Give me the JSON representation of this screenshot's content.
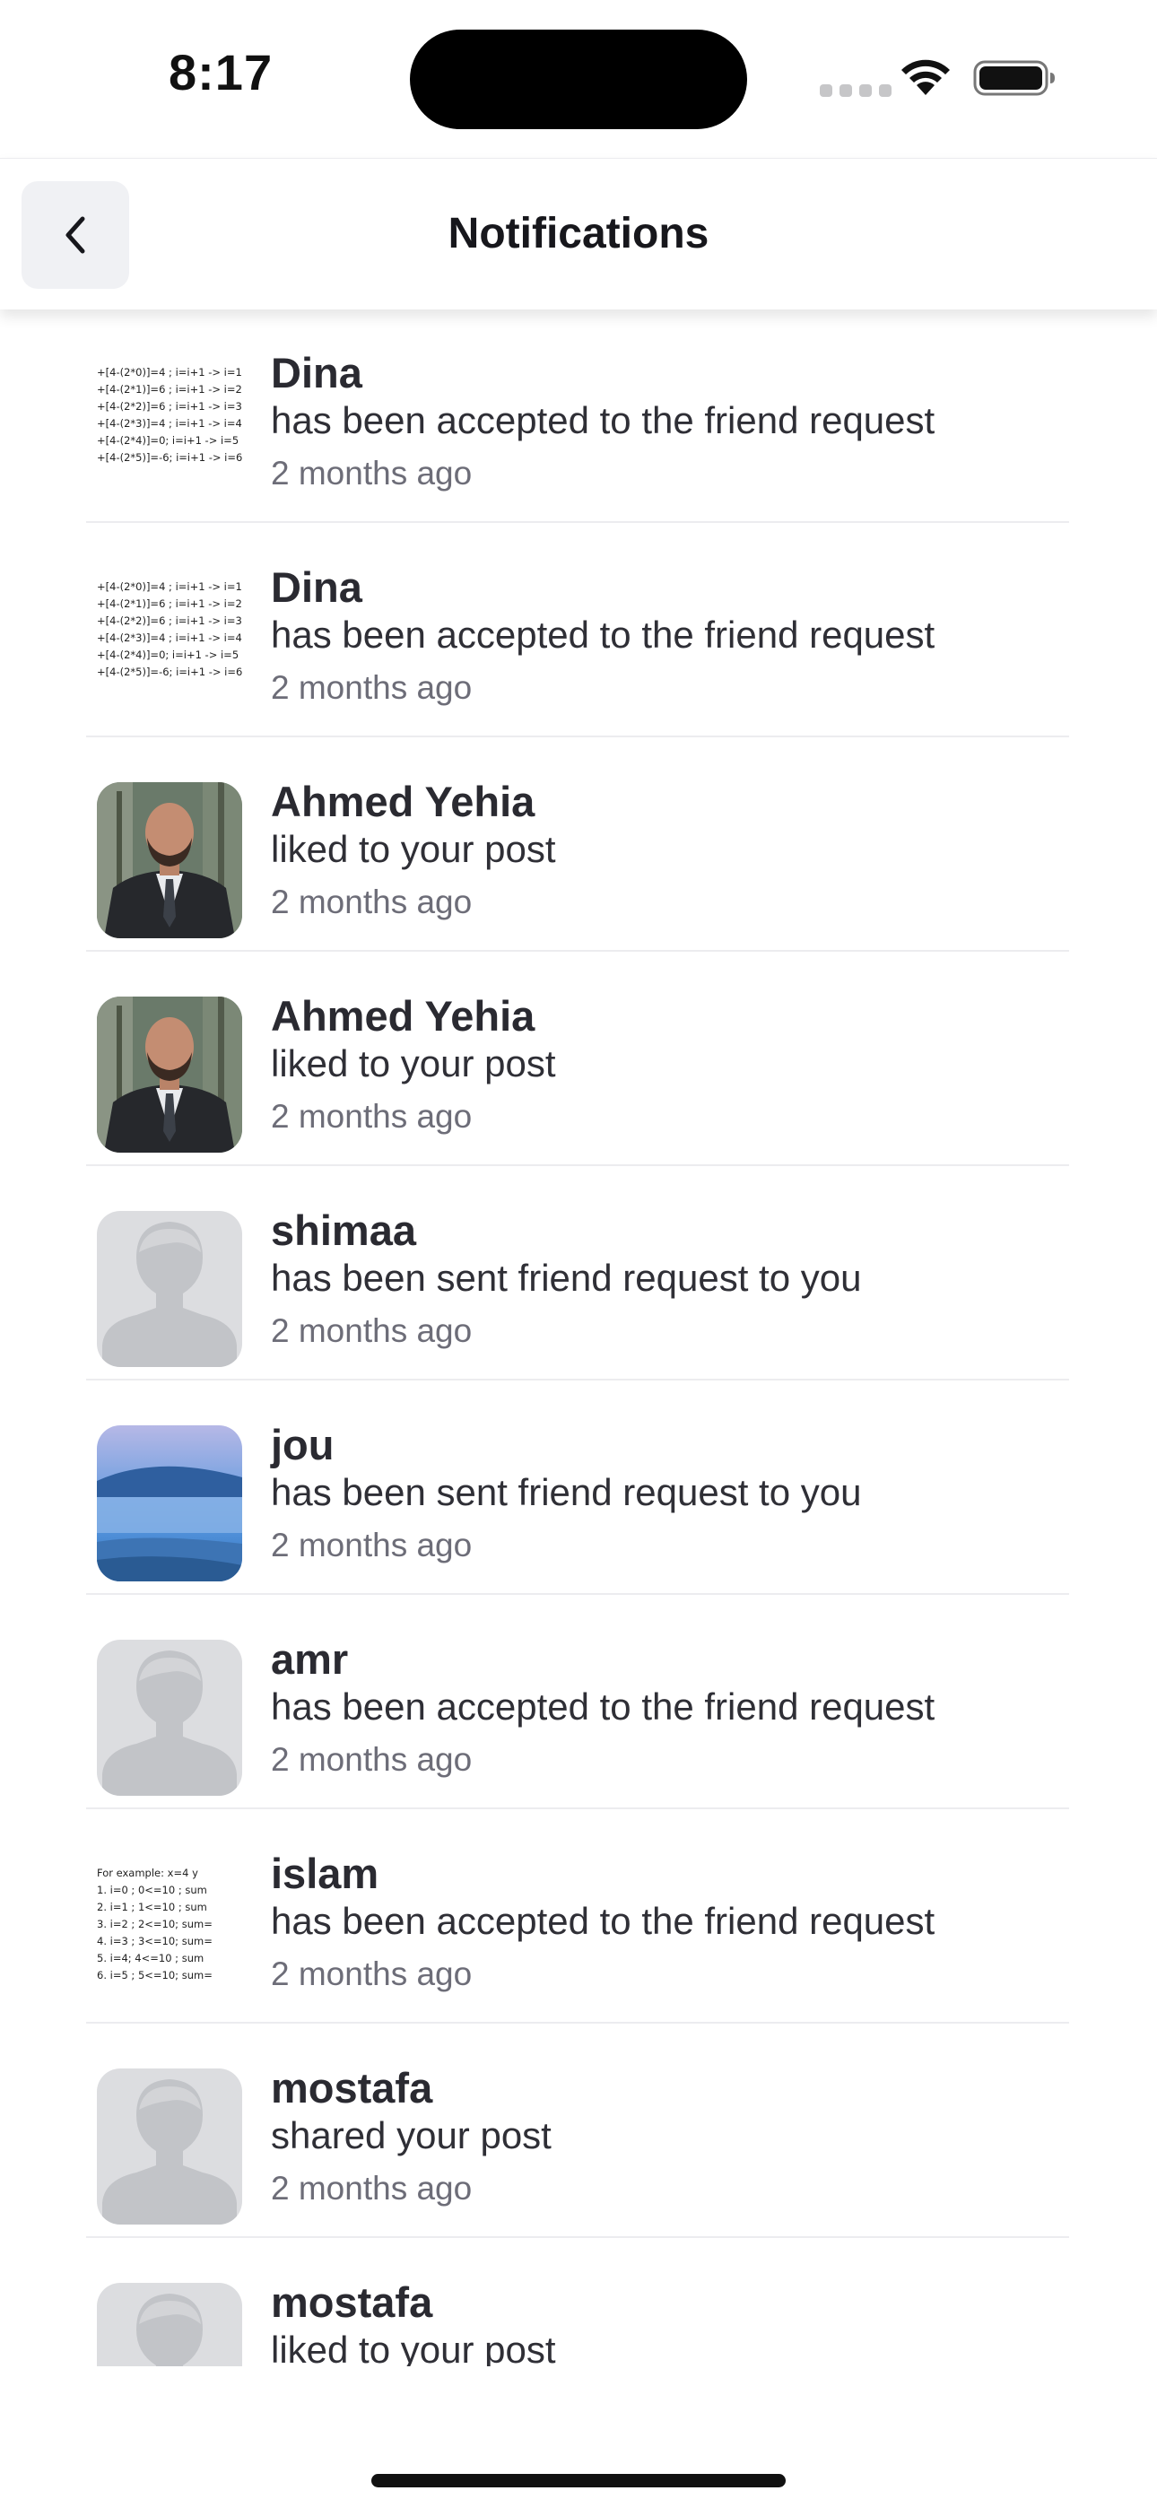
{
  "status_bar": {
    "time": "8:17",
    "icons": [
      "cellular-signal-icon",
      "wifi-icon",
      "battery-icon"
    ]
  },
  "header": {
    "title": "Notifications",
    "back_icon": "chevron-left-icon"
  },
  "thumbnails": {
    "code_a": [
      "+[4-(2*0)]=4 ; i=i+1 -> i=1",
      "+[4-(2*1)]=6 ; i=i+1 -> i=2",
      "+[4-(2*2)]=6 ; i=i+1 -> i=3",
      "+[4-(2*3)]=4 ; i=i+1 -> i=4",
      "+[4-(2*4)]=0; i=i+1 -> i=5",
      "+[4-(2*5)]=-6; i=i+1 -> i=6"
    ],
    "code_b": [
      "For example: x=4 y",
      "1.  i=0 ; 0<=10 ; sum",
      "2.  i=1 ; 1<=10 ; sum",
      "3.  i=2 ; 2<=10; sum=",
      "4.  i=3 ; 3<=10; sum=",
      "5.  i=4; 4<=10 ; sum",
      "6.  i=5 ; 5<=10; sum="
    ]
  },
  "notifications": [
    {
      "name": "Dina",
      "message": "has been accepted to the friend request",
      "time": "2 months ago",
      "avatar": "code-screenshot-a"
    },
    {
      "name": "Dina",
      "message": "has been accepted to the friend request",
      "time": "2 months ago",
      "avatar": "code-screenshot-a"
    },
    {
      "name": "Ahmed Yehia",
      "message": "liked to your post",
      "time": "2 months ago",
      "avatar": "man-in-suit-photo"
    },
    {
      "name": "Ahmed Yehia",
      "message": "liked to your post",
      "time": "2 months ago",
      "avatar": "man-in-suit-photo"
    },
    {
      "name": "shimaa",
      "message": "has been sent friend request to you",
      "time": "2 months ago",
      "avatar": "default-person-icon"
    },
    {
      "name": "jou",
      "message": "has been sent friend request to you",
      "time": "2 months ago",
      "avatar": "misty-landscape-photo"
    },
    {
      "name": "amr",
      "message": "has been accepted to the friend request",
      "time": "2 months ago",
      "avatar": "default-person-icon"
    },
    {
      "name": "islam",
      "message": "has been accepted to the friend request",
      "time": "2 months ago",
      "avatar": "code-screenshot-b"
    },
    {
      "name": "mostafa",
      "message": "shared your post",
      "time": "2 months ago",
      "avatar": "default-person-icon"
    },
    {
      "name": "mostafa",
      "message": "liked to your post",
      "time": "",
      "avatar": "default-person-icon"
    }
  ],
  "colors": {
    "text_primary": "#2a2a31",
    "text_secondary": "#6d6d78",
    "divider": "#ececef",
    "placeholder_bg": "#dcdde0",
    "placeholder_figure": "#c2c4c8"
  }
}
